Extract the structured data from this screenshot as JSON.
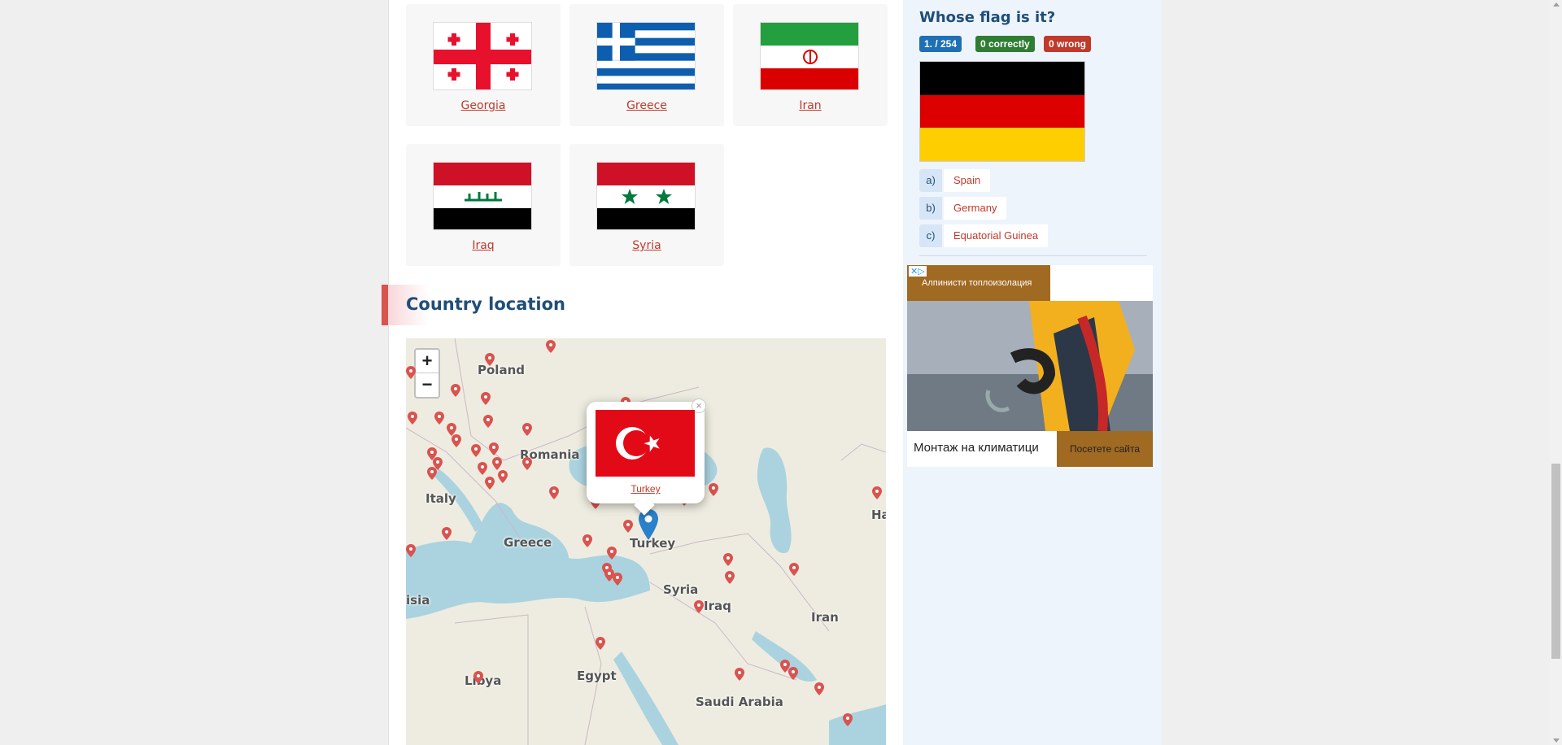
{
  "neighbors": [
    {
      "name": "Georgia",
      "flag": "georgia-flag"
    },
    {
      "name": "Greece",
      "flag": "greece-flag"
    },
    {
      "name": "Iran",
      "flag": "iran-flag"
    },
    {
      "name": "Iraq",
      "flag": "iraq-flag"
    },
    {
      "name": "Syria",
      "flag": "syria-flag"
    }
  ],
  "section": {
    "title": "Country location"
  },
  "map": {
    "zoom_in": "+",
    "zoom_out": "−",
    "labels": [
      "Poland",
      "Romania",
      "Italy",
      "Greece",
      "Turkey",
      "Syria",
      "Iraq",
      "Iran",
      "Egypt",
      "Libya",
      "Saudi Arabia",
      "isia",
      "Ha"
    ],
    "popup": {
      "country": "Turkey",
      "close": "×"
    }
  },
  "quiz": {
    "title": "Whose flag is it?",
    "progress": "1. / 254",
    "correct": "0 correctly",
    "wrong": "0 wrong",
    "flag_colors": [
      "#000000",
      "#dd0000",
      "#ffce00"
    ],
    "answers": [
      {
        "letter": "a)",
        "text": "Spain"
      },
      {
        "letter": "b)",
        "text": "Germany"
      },
      {
        "letter": "c)",
        "text": "Equatorial Guinea"
      }
    ]
  },
  "ad": {
    "headline": "Алпинисти топлоизолация",
    "body": "Монтаж на климатици",
    "cta": "Посетете сайта"
  },
  "colors": {
    "accent": "#1f4e79",
    "link": "#c0392b",
    "pin": "#d9534f",
    "popup_pin": "#2a81cb"
  }
}
